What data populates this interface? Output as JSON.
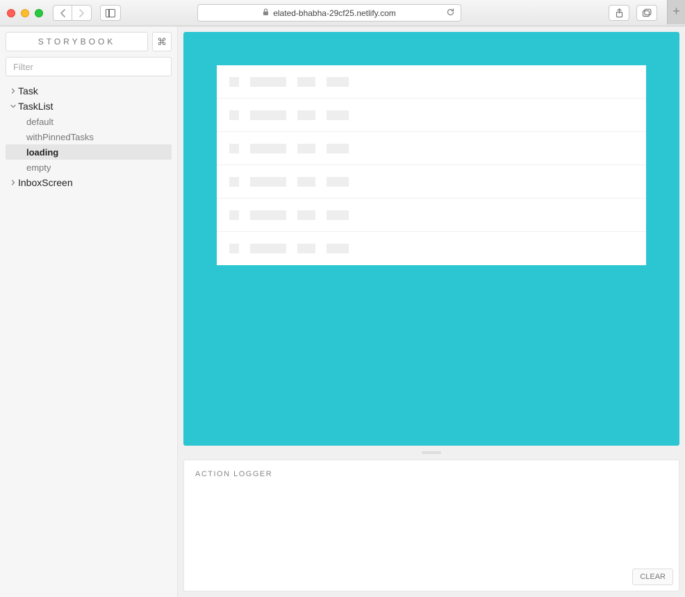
{
  "browser": {
    "url_host": "elated-bhabha-29cf25.netlify.com"
  },
  "sidebar": {
    "brand": "STORYBOOK",
    "shortcut_glyph": "⌘",
    "filter_placeholder": "Filter",
    "tree": [
      {
        "label": "Task",
        "expanded": false,
        "stories": []
      },
      {
        "label": "TaskList",
        "expanded": true,
        "stories": [
          {
            "label": "default",
            "selected": false
          },
          {
            "label": "withPinnedTasks",
            "selected": false
          },
          {
            "label": "loading",
            "selected": true
          },
          {
            "label": "empty",
            "selected": false
          }
        ]
      },
      {
        "label": "InboxScreen",
        "expanded": false,
        "stories": []
      }
    ]
  },
  "preview": {
    "skeleton_row_count": 6
  },
  "action_logger": {
    "title": "ACTION LOGGER",
    "clear_label": "CLEAR"
  }
}
